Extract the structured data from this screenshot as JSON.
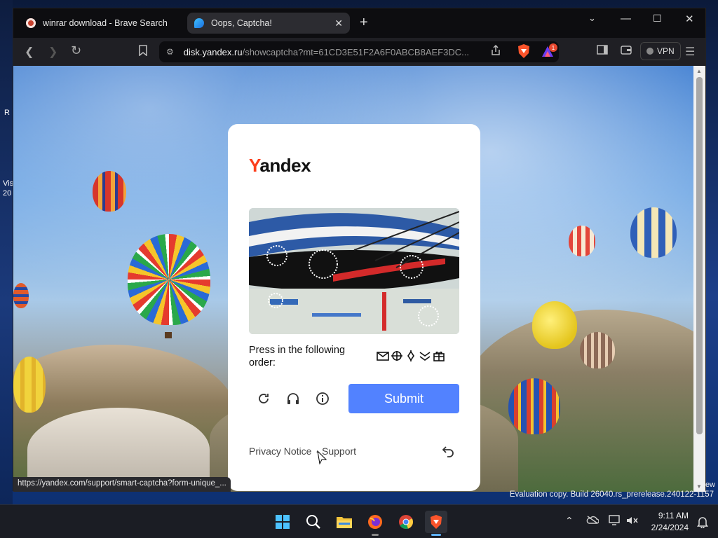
{
  "desktop": {
    "left_glyphs": [
      "R",
      "Vis",
      "20"
    ],
    "right_glyph": "ew"
  },
  "browser": {
    "tabs": [
      {
        "label": "winrar download - Brave Search",
        "active": false
      },
      {
        "label": "Oops, Captcha!",
        "active": true
      }
    ],
    "new_tab": "+",
    "url_host": "disk.yandex.ru",
    "url_path": "/showcaptcha?mt=61CD3E51F2A6F0ABCB8AEF3DC...",
    "vpn_label": "VPN",
    "brave_rewards_badge": "1",
    "status_url": "https://yandex.com/support/smart-captcha?form-unique_..."
  },
  "captcha": {
    "logo_first": "Y",
    "logo_rest": "andex",
    "instruction": "Press in the following order:",
    "order_icons": [
      "envelope-icon",
      "crossed-circle-icon",
      "diamond-pin-icon",
      "double-chevron-icon",
      "gift-icon"
    ],
    "submit_label": "Submit",
    "privacy_label": "Privacy Notice",
    "separator": "·",
    "support_label": "Support",
    "accent_color": "#5282ff",
    "logo_accent": "#fc3f1d"
  },
  "system": {
    "watermark": "Evaluation copy. Build 26040.rs_prerelease.240122-1157",
    "time": "9:11 AM",
    "date": "2/24/2024",
    "taskbar_apps": [
      "start-icon",
      "search-icon",
      "file-explorer-icon",
      "firefox-icon",
      "chrome-icon",
      "brave-icon"
    ]
  }
}
